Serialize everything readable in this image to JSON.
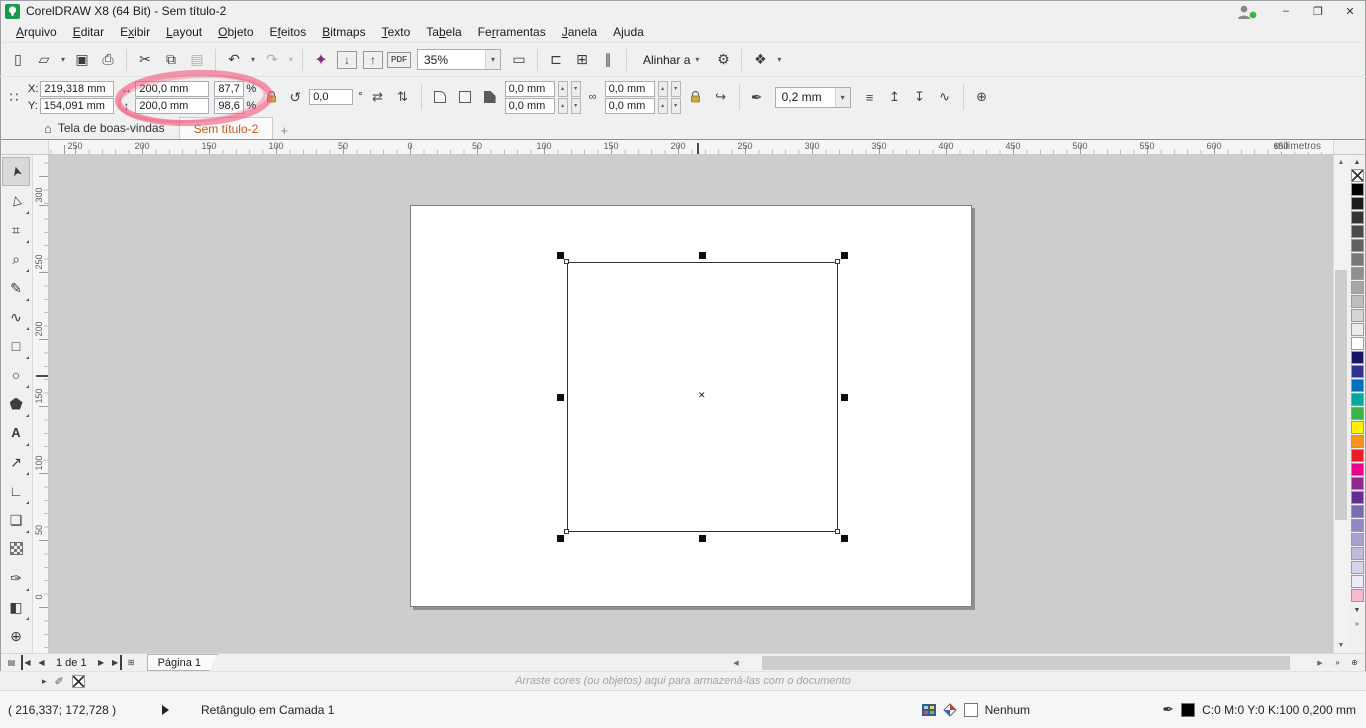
{
  "titlebar": {
    "title": "CorelDRAW X8 (64 Bit) - Sem título-2"
  },
  "theme": {
    "accent_teal": "#35b4c7",
    "annotation_pink": "#f2557c",
    "active_tab_text": "#c75b12",
    "launcher_purple": "#93278f"
  },
  "menubar": {
    "items": [
      {
        "label": "Arquivo",
        "mnemonic": 0
      },
      {
        "label": "Editar",
        "mnemonic": 0
      },
      {
        "label": "Exibir",
        "mnemonic": 1
      },
      {
        "label": "Layout",
        "mnemonic": 0
      },
      {
        "label": "Objeto",
        "mnemonic": 0
      },
      {
        "label": "Efeitos",
        "mnemonic": 1
      },
      {
        "label": "Bitmaps",
        "mnemonic": 0
      },
      {
        "label": "Texto",
        "mnemonic": 0
      },
      {
        "label": "Tabela",
        "mnemonic": 2
      },
      {
        "label": "Ferramentas",
        "mnemonic": 2
      },
      {
        "label": "Janela",
        "mnemonic": 0
      },
      {
        "label": "Ajuda",
        "mnemonic": 1
      }
    ]
  },
  "standard_toolbar": {
    "items": [
      {
        "type": "btn",
        "name": "new-document-button",
        "glyph": "▯"
      },
      {
        "type": "btn",
        "name": "open-document-button",
        "glyph": "▱",
        "arrow": true
      },
      {
        "type": "btn",
        "name": "save-button",
        "glyph": "▣"
      },
      {
        "type": "btn",
        "name": "print-button",
        "glyph": "⎙"
      },
      {
        "type": "sep"
      },
      {
        "type": "btn",
        "name": "cut-button",
        "glyph": "✂"
      },
      {
        "type": "btn",
        "name": "copy-button",
        "glyph": "⧉"
      },
      {
        "type": "btn",
        "name": "paste-button",
        "glyph": "▤",
        "disabled": true
      },
      {
        "type": "sep"
      },
      {
        "type": "btn",
        "name": "undo-button",
        "glyph": "↶",
        "arrow": true
      },
      {
        "type": "btn",
        "name": "redo-button",
        "glyph": "↷",
        "arrow": true,
        "disabled": true
      },
      {
        "type": "sep"
      },
      {
        "type": "btn",
        "name": "search-content-button",
        "glyph": "✦",
        "accent": true
      },
      {
        "type": "btn",
        "name": "import-button",
        "glyph": "↓",
        "boxed": true
      },
      {
        "type": "btn",
        "name": "export-button",
        "glyph": "↑",
        "boxed": true
      },
      {
        "type": "btn",
        "name": "publish-pdf-button",
        "glyph": "PDF",
        "pdf": true
      },
      {
        "type": "combo",
        "name": "zoom-level-combo",
        "value": "35%"
      },
      {
        "type": "btn",
        "name": "fullscreen-preview-button",
        "glyph": "▭"
      },
      {
        "type": "sep"
      },
      {
        "type": "btn",
        "name": "show-rulers-button",
        "glyph": "⊏"
      },
      {
        "type": "btn",
        "name": "show-grid-button",
        "glyph": "⊞"
      },
      {
        "type": "btn",
        "name": "show-guidelines-button",
        "glyph": "∥"
      },
      {
        "type": "sep"
      },
      {
        "type": "textcombo",
        "name": "snap-to-dropdown",
        "value": "Alinhar a"
      },
      {
        "type": "btn",
        "name": "options-button",
        "glyph": "⚙"
      },
      {
        "type": "sep"
      },
      {
        "type": "btn",
        "name": "application-launcher-button",
        "glyph": "❖",
        "arrow": true
      }
    ]
  },
  "property_bar": {
    "position_x_label": "X:",
    "position_x": "219,318 mm",
    "position_y_label": "Y:",
    "position_y": "154,091 mm",
    "object_width": "200,0 mm",
    "object_height": "200,0 mm",
    "scale_width": "87,7",
    "scale_height": "98,6",
    "percent": "%",
    "rotation_angle": "0,0",
    "degree": "°",
    "corner_radius_top_left": "0,0 mm",
    "corner_radius_bottom_left": "0,0 mm",
    "corner_radius_top_right": "0,0 mm",
    "corner_radius_bottom_right": "0,0 mm",
    "outline_width": "0,2 mm"
  },
  "document_tabs": {
    "welcome_label": "Tela de boas-vindas",
    "document_label": "Sem título-2",
    "new_tab_label": "+"
  },
  "rulers": {
    "unit_label": "milímetros",
    "horizontal_ticks": [
      "250",
      "200",
      "150",
      "100",
      "50",
      "0",
      "50",
      "100",
      "150",
      "200",
      "250",
      "300",
      "350",
      "400",
      "450",
      "500",
      "550",
      "600",
      "650"
    ],
    "vertical_ticks": [
      "300",
      "250",
      "200",
      "150",
      "100",
      "50",
      "0"
    ]
  },
  "toolbox": {
    "tools": [
      {
        "name": "pick-tool",
        "glyph": "➤",
        "active": true
      },
      {
        "name": "shape-tool",
        "glyph": "▷",
        "flyout": true
      },
      {
        "name": "crop-tool",
        "glyph": "⌗",
        "flyout": true
      },
      {
        "name": "zoom-tool",
        "glyph": "⌕",
        "flyout": true
      },
      {
        "name": "freehand-tool",
        "glyph": "✎",
        "flyout": true
      },
      {
        "name": "artistic-media-tool",
        "glyph": "∿",
        "flyout": true
      },
      {
        "name": "rectangle-tool",
        "glyph": "□",
        "flyout": true
      },
      {
        "name": "ellipse-tool",
        "glyph": "○",
        "flyout": true
      },
      {
        "name": "polygon-tool",
        "glyph": "",
        "shape": "pentagon",
        "flyout": true
      },
      {
        "name": "text-tool",
        "glyph": "A",
        "flyout": true
      },
      {
        "name": "parallel-dimension-tool",
        "glyph": "↗",
        "flyout": true
      },
      {
        "name": "connector-tool",
        "glyph": "∟",
        "flyout": true
      },
      {
        "name": "drop-shadow-tool",
        "glyph": "❏",
        "flyout": true
      },
      {
        "name": "transparency-tool",
        "glyph": "",
        "shape": "checker"
      },
      {
        "name": "color-eyedropper-tool",
        "glyph": "✑",
        "flyout": true
      },
      {
        "name": "interactive-fill-tool",
        "glyph": "◧",
        "flyout": true
      },
      {
        "name": "add-tools-button",
        "glyph": "⊕"
      }
    ]
  },
  "color_palette": {
    "swatches": [
      "none",
      "#000000",
      "#1c1c1c",
      "#333333",
      "#4a4a4a",
      "#616161",
      "#787878",
      "#8f8f8f",
      "#a6a6a6",
      "#bdbdbd",
      "#d4d4d4",
      "#ebebeb",
      "#ffffff",
      "#1b1464",
      "#2e3192",
      "#0071bc",
      "#00a99d",
      "#39b54a",
      "#fff200",
      "#f7941e",
      "#ed1c24",
      "#ec008c",
      "#92278f",
      "#662d91",
      "#7b6bb0",
      "#9287c0",
      "#a9a1d0",
      "#c0bade",
      "#d7d3ea",
      "#eeeaf6",
      "#f7b8d4"
    ]
  },
  "page_navigation": {
    "current": "1 de 1",
    "page_tab": "Página 1"
  },
  "document_palette": {
    "hint": "Arraste cores (ou objetos) aqui para armazená-las com o documento"
  },
  "status_bar": {
    "pointer_position": "( 216,337; 172,728 )",
    "selection_info": "Retângulo em Camada 1",
    "fill_label": "Nenhum",
    "outline_label": "C:0 M:0 Y:0 K:100  0,200 mm"
  },
  "icons": {
    "minimize": "–",
    "restore": "❐",
    "close": "✕",
    "dropdown": "▾",
    "spin_up": "▴",
    "spin_down": "▾",
    "object_position": "∷",
    "width": "↔",
    "height": "↕",
    "rotation": "↺",
    "mirror_horizontal": "⇄",
    "mirror_vertical": "⇅",
    "chain": "∞",
    "relative_corner": "↪",
    "outline_pen": "✒",
    "wrap_text": "≡",
    "to_front": "↥",
    "to_back": "↧",
    "convert_to_curves": "∿",
    "add_more": "⊕",
    "home": "⌂",
    "scroll_up": "▲",
    "scroll_down": "▼",
    "scroll_left": "◀",
    "scroll_right": "▶",
    "palette_more": "»",
    "page_list": "▤",
    "nav_first": "◀",
    "nav_prev": "◀",
    "nav_next": "▶",
    "nav_last": "▶",
    "add_page": "⊞",
    "flyout_arrow": "▸",
    "eyedropper_small": "✐",
    "zoom_fit": "⊕",
    "center_marker": "✕"
  }
}
